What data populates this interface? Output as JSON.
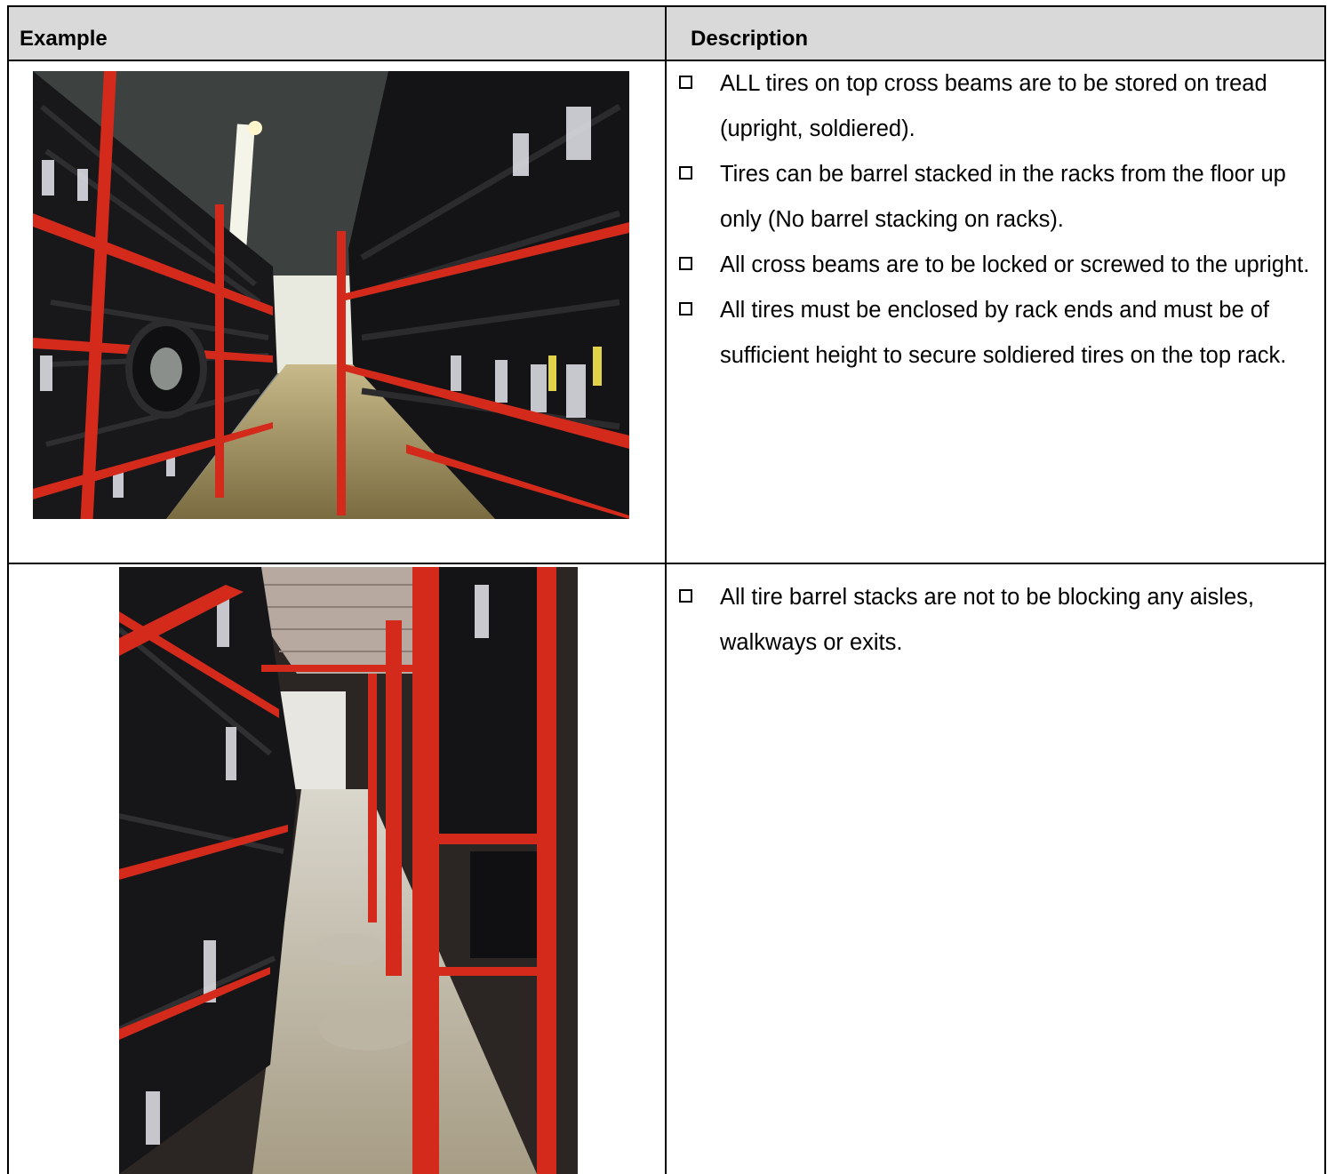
{
  "table": {
    "headers": {
      "example": "Example",
      "description": "Description"
    },
    "rows": [
      {
        "photo": "tire-warehouse-aisle-red-racks-photo",
        "items": [
          "ALL tires on top cross beams are to be stored on tread (upright, soldiered).",
          "Tires can be barrel stacked in the racks from the floor up only (No barrel stacking on racks).",
          "All cross beams are to be locked or screwed to the upright.",
          "All tires must be enclosed by rack ends and must be of sufficient height to secure soldiered tires on the top rack."
        ]
      },
      {
        "photo": "narrow-tire-storage-aisle-photo",
        "items": [
          "All tire barrel stacks are not to be blocking any aisles, walkways or exits."
        ]
      }
    ]
  },
  "colors": {
    "header_bg": "#d9d9d9",
    "rack_red": "#d42a1c",
    "tire_black": "#1b1b1d",
    "floor": "#b3a98e"
  },
  "icons": {
    "bullet": "empty-checkbox-icon"
  }
}
